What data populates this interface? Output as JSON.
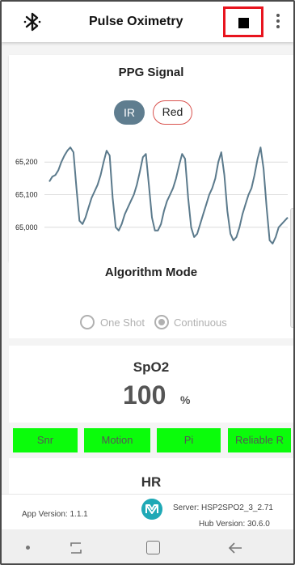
{
  "header": {
    "title": "Pulse Oximetry",
    "bluetooth_icon": "bluetooth-icon",
    "stop_icon": "stop-icon",
    "menu_icon": "more-vert-icon"
  },
  "ppg": {
    "title": "PPG Signal",
    "toggle_ir": "IR",
    "toggle_red": "Red",
    "y_ticks": [
      "65,200",
      "65,100",
      "65,000"
    ]
  },
  "chart_data": {
    "type": "line",
    "title": "",
    "xlabel": "",
    "ylabel": "",
    "ylim": [
      64920,
      65280
    ],
    "y_ticks": [
      65000,
      65100,
      65200
    ],
    "grid": true,
    "series": [
      {
        "color": "#5b7a8c",
        "x": [
          0,
          4,
          8,
          12,
          16,
          20,
          24,
          28,
          32,
          36,
          40,
          44,
          48,
          52,
          56,
          60,
          64,
          68,
          72,
          76,
          80,
          84,
          88,
          92,
          96,
          100,
          104,
          108,
          112,
          116,
          120,
          124,
          128,
          132,
          136,
          140,
          144,
          148,
          152,
          156,
          160,
          164,
          168,
          172,
          176,
          180,
          184,
          188,
          192,
          196,
          200,
          204,
          208,
          212,
          216,
          220,
          224,
          228,
          232,
          236,
          240,
          244,
          248,
          252,
          256,
          260,
          264,
          268,
          272,
          276,
          280,
          284,
          288,
          292,
          296,
          300,
          304,
          308,
          312,
          316
        ],
        "values": [
          65140,
          65155,
          65160,
          65175,
          65200,
          65220,
          65235,
          65245,
          65230,
          65120,
          65020,
          65010,
          65030,
          65060,
          65090,
          65110,
          65130,
          65160,
          65200,
          65235,
          65220,
          65090,
          65000,
          64990,
          65010,
          65040,
          65060,
          65080,
          65100,
          65130,
          65170,
          65215,
          65225,
          65130,
          65030,
          64990,
          64990,
          65010,
          65050,
          65080,
          65100,
          65120,
          65150,
          65190,
          65225,
          65210,
          65090,
          65000,
          64970,
          64980,
          65010,
          65040,
          65070,
          65100,
          65120,
          65150,
          65200,
          65230,
          65160,
          65050,
          64980,
          64960,
          64970,
          65000,
          65040,
          65070,
          65100,
          65120,
          65160,
          65210,
          65245,
          65180,
          65060,
          64960,
          64950,
          64970,
          65000,
          65010,
          65020,
          65030
        ]
      }
    ]
  },
  "algorithm": {
    "title": "Algorithm Mode",
    "option_one_shot": "One Shot",
    "option_continuous": "Continuous",
    "selected": "Continuous"
  },
  "spo2": {
    "title": "SpO2",
    "value": "100",
    "unit": "%"
  },
  "status_badges": {
    "snr": "Snr",
    "motion": "Motion",
    "pi": "Pi",
    "reliable": "Reliable R",
    "color": "#0bfc0b"
  },
  "hr": {
    "title": "HR"
  },
  "footer": {
    "app_version": "App Version: 1.1.1",
    "server": "Server: HSP2SPO2_3_2.71",
    "hub_version": "Hub Version: 30.6.0",
    "logo_icon": "maxim-logo-icon"
  },
  "accent": {
    "ir_color": "#5f7d8f",
    "red_border": "#d9534f",
    "highlight": "#e8141e"
  }
}
